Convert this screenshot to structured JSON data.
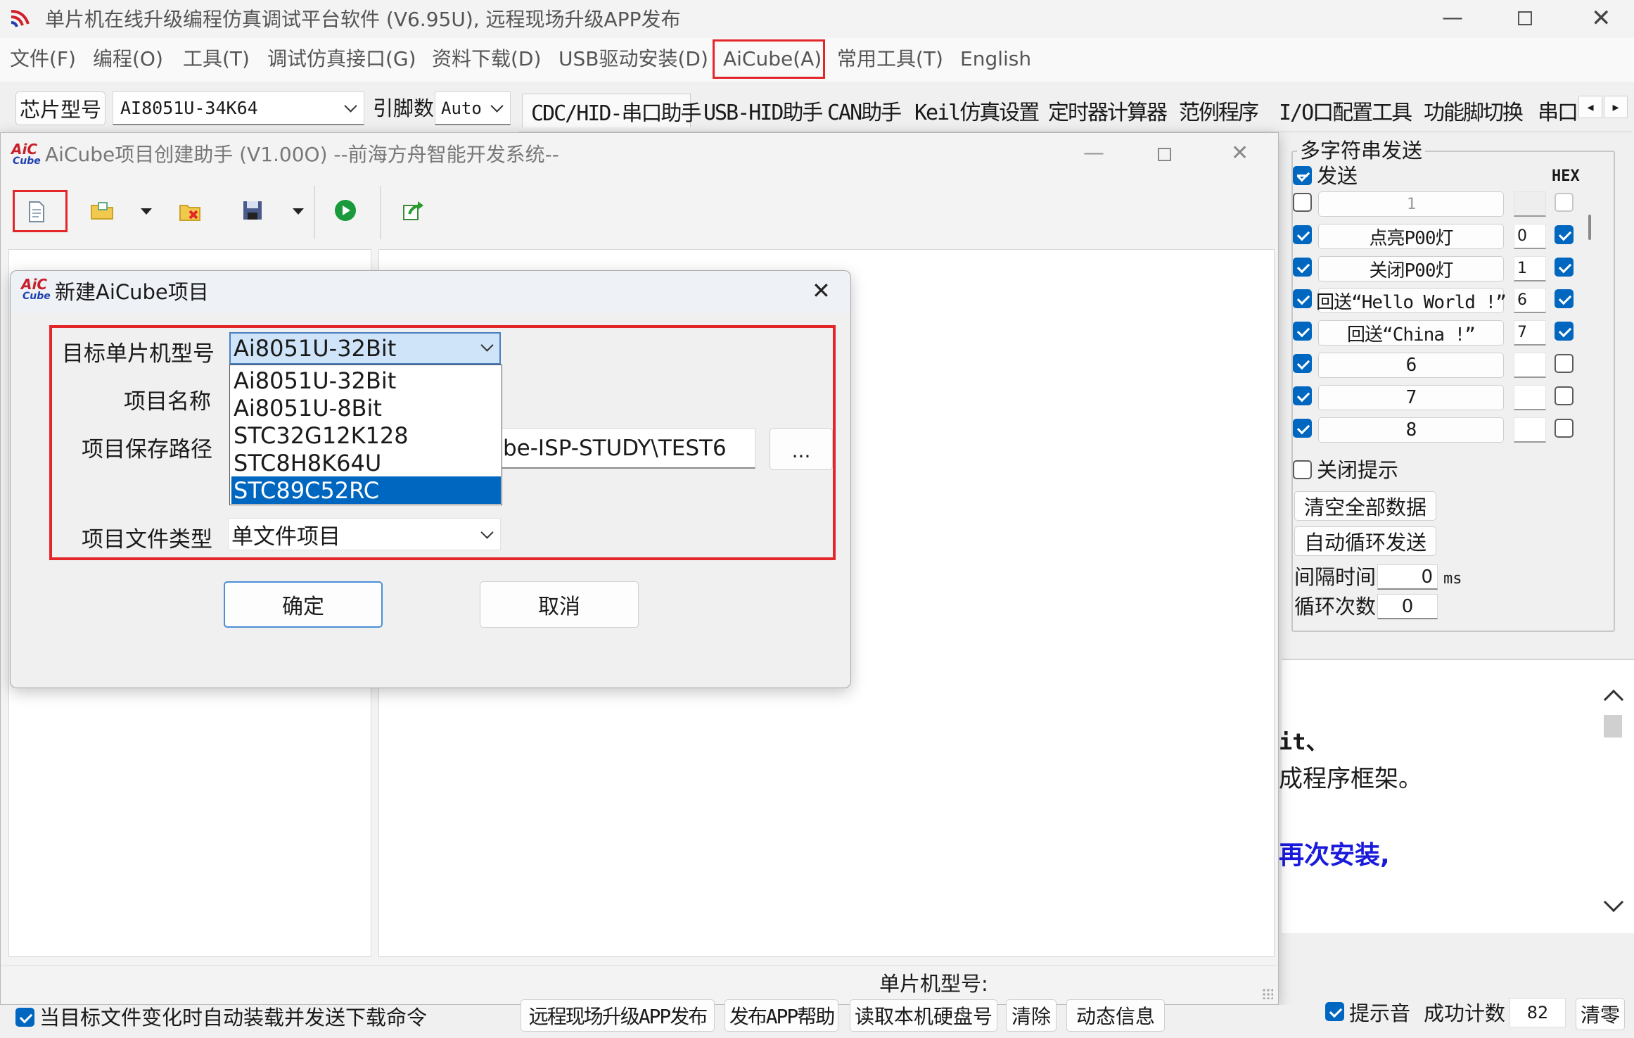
{
  "main_window": {
    "title": "单片机在线升级编程仿真调试平台软件 (V6.95U), 远程现场升级APP发布",
    "menu": [
      "文件(F)",
      "编程(O)",
      "工具(T)",
      "调试仿真接口(G)",
      "资料下载(D)",
      "USB驱动安装(D)",
      "AiCube(A)",
      "常用工具(T)",
      "English"
    ]
  },
  "toolbar": {
    "chip_label": "芯片型号",
    "chip_value": "AI8051U-34K64",
    "pins_label": "引脚数",
    "pins_value": "Auto",
    "tabs": [
      "CDC/HID-串口助手",
      "USB-HID助手",
      "CAN助手",
      "Keil仿真设置",
      "定时器计算器",
      "范例程序",
      "I/O口配置工具",
      "功能脚切换",
      "串口"
    ]
  },
  "aicube_window": {
    "logo_top": "AiC",
    "logo_bottom": "Cube",
    "title": "AiCube项目创建助手 (V1.00O) --前海方舟智能开发系统--"
  },
  "dialog": {
    "title": "新建AiCube项目",
    "labels": {
      "mcu": "目标单片机型号",
      "name": "项目名称",
      "path": "项目保存路径",
      "type": "项目文件类型"
    },
    "mcu_selected": "Ai8051U-32Bit",
    "mcu_options": [
      "Ai8051U-32Bit",
      "Ai8051U-8Bit",
      "STC32G12K128",
      "STC8H8K64U",
      "STC89C52RC"
    ],
    "mcu_highlighted": "STC89C52RC",
    "path_value": "be-ISP-STUDY\\TEST6",
    "browse_label": "...",
    "type_value": "单文件项目",
    "ok_label": "确定",
    "cancel_label": "取消"
  },
  "multi_send": {
    "group_title": "多字符串发送",
    "send_label": "发送",
    "hex_label": "HEX",
    "rows": [
      {
        "text": "1",
        "num": "",
        "checked": false,
        "hex": false
      },
      {
        "text": "点亮P00灯",
        "num": "0",
        "checked": true,
        "hex": true
      },
      {
        "text": "关闭P00灯",
        "num": "1",
        "checked": true,
        "hex": true
      },
      {
        "text": "回送“Hello World !”",
        "num": "6",
        "checked": true,
        "hex": true
      },
      {
        "text": "回送“China !”",
        "num": "7",
        "checked": true,
        "hex": true
      },
      {
        "text": "6",
        "num": "",
        "checked": true,
        "hex": false
      },
      {
        "text": "7",
        "num": "",
        "checked": true,
        "hex": false
      },
      {
        "text": "8",
        "num": "",
        "checked": true,
        "hex": false
      }
    ],
    "close_hint": "关闭提示",
    "clear_all": "清空全部数据",
    "auto_loop": "自动循环发送",
    "interval_label": "间隔时间",
    "interval_value": "0",
    "interval_unit": "ms",
    "loop_label": "循环次数",
    "loop_value": "0"
  },
  "log": {
    "line1": "it、",
    "line2": "成程序框架。",
    "line3": "再次安装,"
  },
  "status": {
    "mcu_model_label": "单片机型号:"
  },
  "bottom": {
    "auto_load": "当目标文件变化时自动装载并发送下载命令",
    "buttons": [
      "远程现场升级APP发布",
      "发布APP帮助",
      "读取本机硬盘号",
      "清除",
      "动态信息"
    ],
    "beep": "提示音",
    "success_label": "成功计数",
    "success_value": "82",
    "clear_label": "清零"
  },
  "colors": {
    "accent": "#0067c0",
    "highlight_red": "#e3262a",
    "selection": "#0067c0",
    "link_blue": "#1a1adc"
  }
}
